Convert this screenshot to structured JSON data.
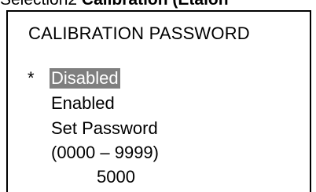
{
  "caption": {
    "prefix": "Selection2 ",
    "bold": "Calibration (Etalon"
  },
  "screen": {
    "title": "CALIBRATION PASSWORD",
    "selected_marker": "*",
    "options": [
      "Disabled",
      "Enabled",
      "Set Password"
    ],
    "range_hint": "(0000 – 9999)",
    "value": "5000"
  },
  "colors": {
    "highlight_bg": "#7f7f7f",
    "highlight_fg": "#ffffff",
    "border": "#000000"
  }
}
